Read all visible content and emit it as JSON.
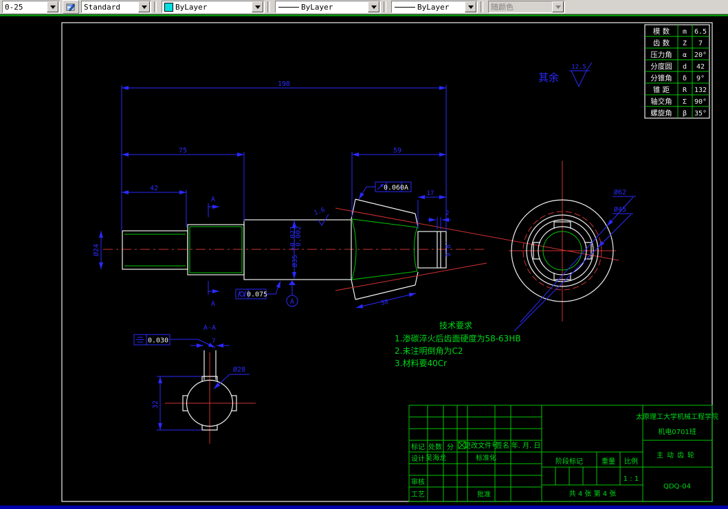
{
  "toolbar": {
    "layer": "0-25",
    "text_style": "Standard",
    "color": "ByLayer",
    "linetype": "ByLayer",
    "lineweight": "ByLayer",
    "plot_style": "随颜色"
  },
  "general_note": {
    "label": "其余",
    "roughness": "12.5"
  },
  "param_table": {
    "rows": [
      {
        "label": "模 数",
        "sym": "m",
        "val": "6.5"
      },
      {
        "label": "齿 数",
        "sym": "Z",
        "val": "7"
      },
      {
        "label": "压力角",
        "sym": "α",
        "val": "20°"
      },
      {
        "label": "分度圆",
        "sym": "d",
        "val": "42"
      },
      {
        "label": "分锥角",
        "sym": "δ",
        "val": "9°"
      },
      {
        "label": "锥 距",
        "sym": "R",
        "val": "132"
      },
      {
        "label": "轴交角",
        "sym": "Σ",
        "val": "90°"
      },
      {
        "label": "螺旋角",
        "sym": "β",
        "val": "35°"
      }
    ]
  },
  "dims": {
    "overall": "198",
    "len75": "75",
    "len59": "59",
    "len42": "42",
    "len17": "17",
    "len2": "2",
    "dia24": "Ø24",
    "dia35": "Ø35",
    "dia35_up": "+0.021",
    "dia35_dn": "-0.002",
    "angle": "9°8'",
    "len38": "38",
    "dia62": "Ø62",
    "dia45": "Ø45",
    "len32": "32",
    "len7": "7",
    "dia28": "Ø28",
    "rough": "1.6"
  },
  "gdt": {
    "runout_val": "0.060",
    "runout_datum": "A",
    "cyl_val": "0.075",
    "sym_val": "0.030",
    "datum": "A"
  },
  "section": {
    "mark": "A",
    "title": "A-A"
  },
  "tech": {
    "title": "技术要求",
    "items": [
      "1.渗碳淬火后齿面硬度为58-63HB",
      "2.未注明倒角为C2",
      "3.材料要40Cr"
    ]
  },
  "titleblock": {
    "school": "太原理工大学机械工程学院",
    "class_name": "机电0701班",
    "part_name": "主动齿轮",
    "drawing_no": "QDQ-04",
    "scale_val": "1 : 1",
    "sheet_note": "共 4 张 第 4 张",
    "labels": {
      "mark": "标记",
      "count": "处数",
      "zone": "分",
      "doc_no": "更改文件号",
      "sign": "签名",
      "date": "年. 月. 日",
      "design": "设计",
      "designer": "吴海龙",
      "std": "标准化",
      "check": "审核",
      "process": "工艺",
      "approve": "批准",
      "stage": "阶段标记",
      "weight": "重量",
      "scale": "比例"
    }
  }
}
